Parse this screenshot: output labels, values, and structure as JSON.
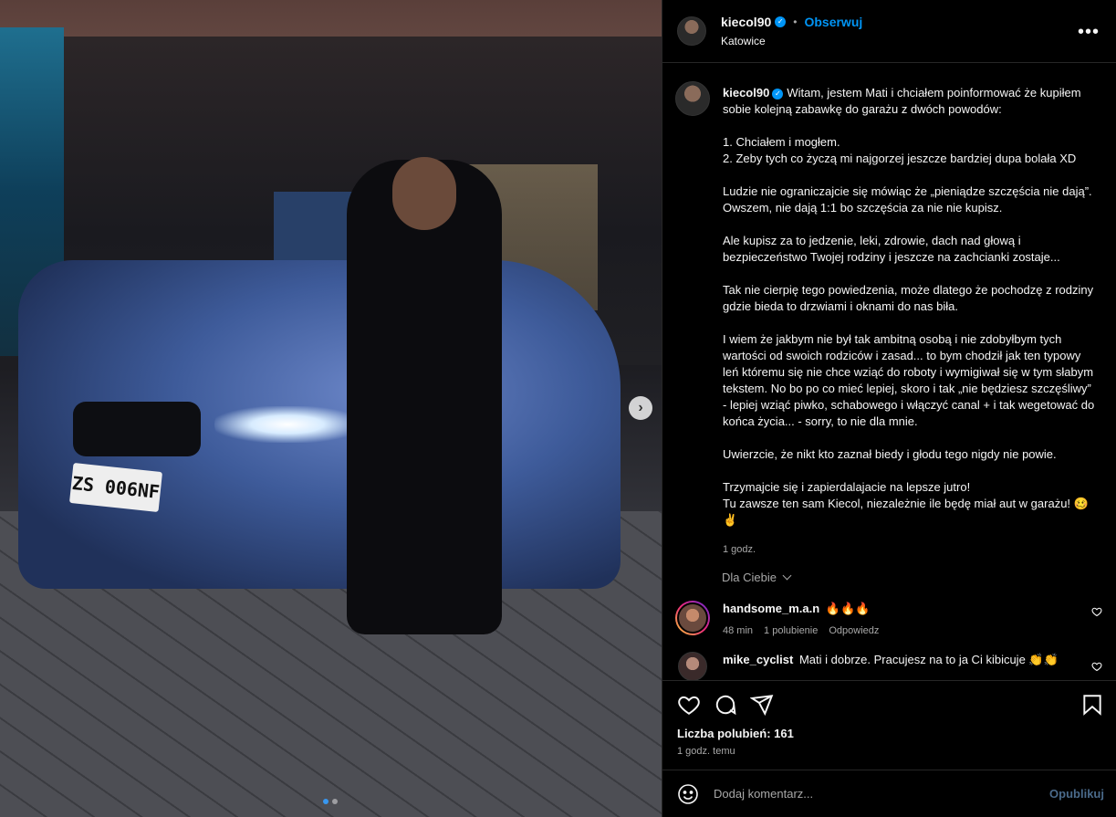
{
  "post": {
    "username": "kiecol90",
    "verified_mark": "✓",
    "separator": "•",
    "follow_label": "Obserwuj",
    "location": "Katowice",
    "more_label": "•••",
    "plate_text": "ZS 006NF",
    "carousel_next": "›",
    "carousel": {
      "total": 2,
      "active": 1
    }
  },
  "caption": {
    "username": "kiecol90",
    "first": "Witam, jestem Mati i chciałem poinformować że kupiłem sobie kolejną zabawkę do garażu z dwóch powodów:",
    "reasons": [
      "1. Chciałem i mogłem.",
      "2. Zeby tych co życzą mi najgorzej jeszcze bardziej dupa bolała XD"
    ],
    "p2": "Ludzie nie ograniczajcie się mówiąc że „pieniądze szczęścia nie dają”. Owszem, nie dają 1:1 bo szczęścia za nie nie kupisz.",
    "p3": "Ale kupisz za to jedzenie, leki, zdrowie, dach nad głową i bezpieczeństwo Twojej rodziny i jeszcze na zachcianki zostaje...",
    "p4": "Tak nie cierpię tego powiedzenia, może dlatego że pochodzę z rodziny gdzie bieda to drzwiami i oknami do nas biła.",
    "p5": "I wiem że jakbym nie był tak ambitną osobą i nie zdobyłbym tych wartości od swoich rodziców i zasad... to bym chodził jak ten typowy leń któremu się nie chce wziąć do roboty i wymigiwał się w tym słabym tekstem. No bo po co mieć lepiej, skoro i tak „nie będziesz szczęśliwy” - lepiej wziąć piwko, schabowego i włączyć canal + i tak wegetować do końca życia... - sorry, to nie dla mnie.",
    "p6": "Uwierzcie, że nikt kto zaznał biedy i głodu tego nigdy nie powie.",
    "p7a": "Trzymajcie się i zapierdalajacie na lepsze jutro!",
    "p7b": "Tu zawsze ten sam Kiecol, niezależnie ile będę miał aut w garażu! 🥴✌️",
    "time": "1 godz."
  },
  "for_you_label": "Dla Ciebie",
  "comments": [
    {
      "username": "handsome_m.a.n",
      "text": "🔥🔥🔥",
      "time": "48 min",
      "likes": "1 polubienie",
      "reply": "Odpowiedz"
    },
    {
      "username": "mike_cyclist",
      "text": "Mati i dobrze. Pracujesz na to ja Ci kibicuje 👏👏"
    }
  ],
  "likes_text": "Liczba polubień: 161",
  "posted_time": "1 godz. temu",
  "comment_placeholder": "Dodaj komentarz...",
  "publish_label": "Opublikuj",
  "icons": [
    "heart-icon",
    "comment-icon",
    "share-icon",
    "bookmark-icon",
    "emoji-icon",
    "chevron-down-icon",
    "chevron-right-icon",
    "more-icon",
    "verified-icon"
  ],
  "colors": {
    "accent": "#0095f6",
    "muted": "#a8a8a8",
    "background": "#000000"
  }
}
